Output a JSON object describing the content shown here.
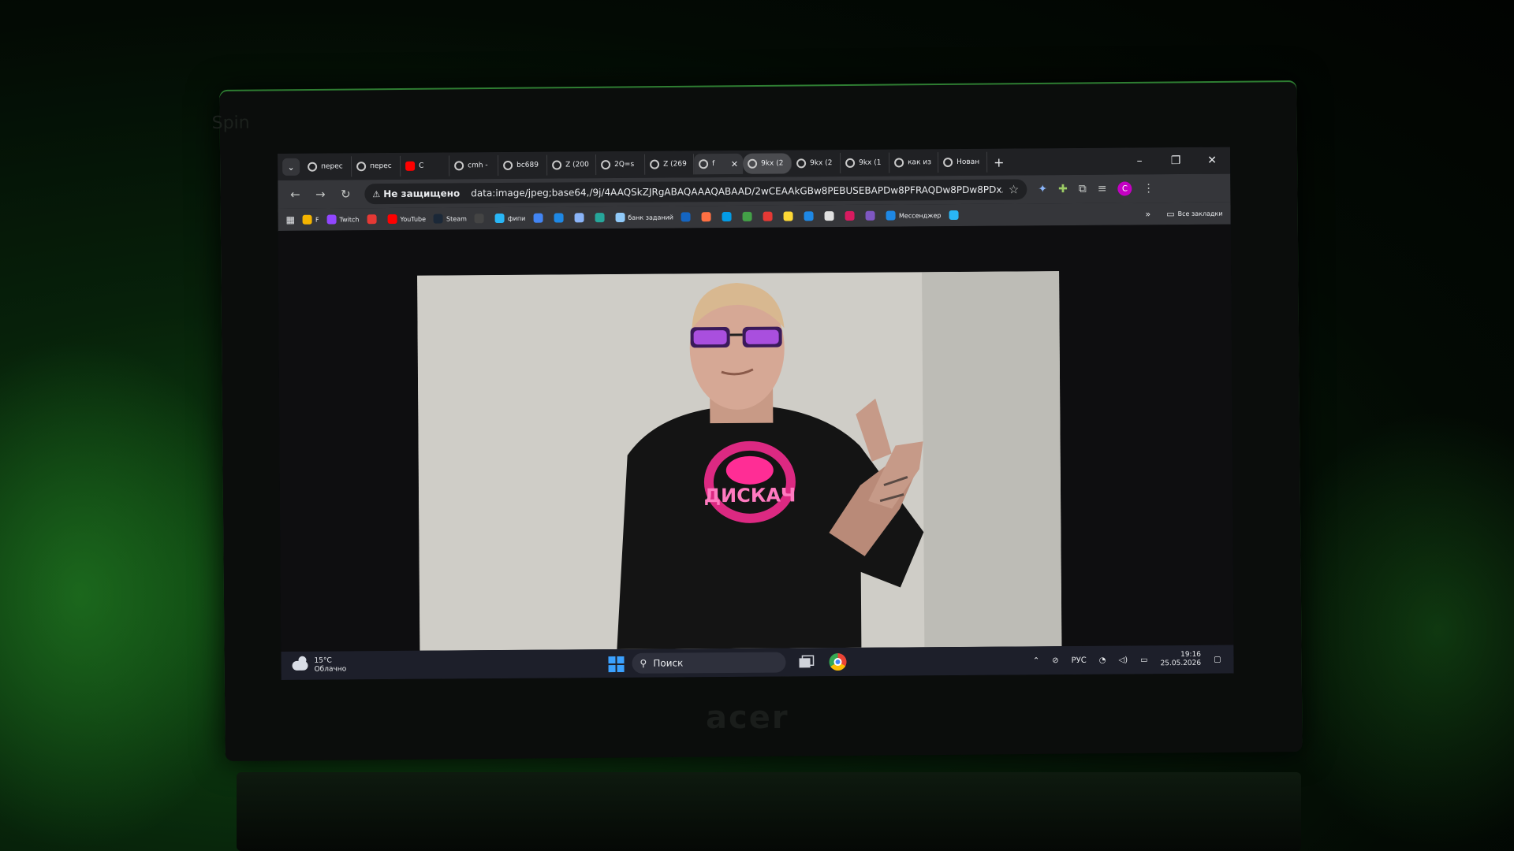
{
  "scene": {
    "ghost_text": "Spin",
    "laptop_logo": "acer"
  },
  "tabs": [
    {
      "label": "перес"
    },
    {
      "label": "перес"
    },
    {
      "label": "С"
    },
    {
      "label": "cmh -"
    },
    {
      "label": "bc689"
    },
    {
      "label": "Z (200"
    },
    {
      "label": "2Q=s"
    },
    {
      "label": "Z (269"
    },
    {
      "label": "f"
    },
    {
      "label": "9kx (2"
    },
    {
      "label": "9kx (2"
    },
    {
      "label": "9kx (1"
    },
    {
      "label": "как из"
    },
    {
      "label": "Нован"
    }
  ],
  "toolbar": {
    "security_label": "Не защищено",
    "url": "data:image/jpeg;base64,/9j/4AAQSkZJRgABAQAAAQABAAD/2wCEAAkGBw8PEBUSEBAPDw8PFRAQDw8PDw8PDxA..."
  },
  "profile": {
    "initial": "C",
    "color": "#c400c4"
  },
  "bookmarks": [
    {
      "label": "F",
      "color": "#f4b400"
    },
    {
      "label": "Twitch",
      "color": "#9146ff"
    },
    {
      "label": "",
      "color": "#e53935"
    },
    {
      "label": "YouTube",
      "color": "#ff0000"
    },
    {
      "label": "Steam",
      "color": "#1b2838"
    },
    {
      "label": "",
      "color": "#444"
    },
    {
      "label": "фипи",
      "color": "#29b6f6"
    },
    {
      "label": "",
      "color": "#4285f4"
    },
    {
      "label": "",
      "color": "#1e88e5"
    },
    {
      "label": "",
      "color": "#8ab4f8"
    },
    {
      "label": "",
      "color": "#26a69a"
    },
    {
      "label": "банк заданий",
      "color": "#90caf9"
    },
    {
      "label": "",
      "color": "#1565c0"
    },
    {
      "label": "",
      "color": "#ff7043"
    },
    {
      "label": "",
      "color": "#039be5"
    },
    {
      "label": "",
      "color": "#43a047"
    },
    {
      "label": "",
      "color": "#e53935"
    },
    {
      "label": "",
      "color": "#fdd835"
    },
    {
      "label": "",
      "color": "#1e88e5"
    },
    {
      "label": "",
      "color": "#e0e0e0"
    },
    {
      "label": "",
      "color": "#d81b60"
    },
    {
      "label": "",
      "color": "#7e57c2"
    },
    {
      "label": "Мессенджер",
      "color": "#1e88e5"
    },
    {
      "label": "",
      "color": "#29b6f6"
    }
  ],
  "bookmarks_folder": "Все закладки",
  "taskbar": {
    "weather_temp": "15°C",
    "weather_desc": "Облачно",
    "search_placeholder": "Поиск",
    "language": "РУС",
    "time": "19:16",
    "date": "25.05.2026"
  },
  "photo": {
    "shirt_text": "ДИСКАЧ",
    "accent": "#ff2d95"
  }
}
